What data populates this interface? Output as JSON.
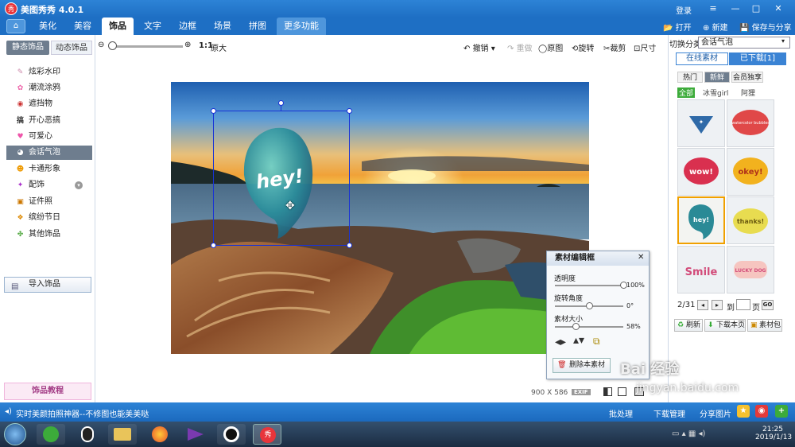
{
  "window": {
    "title": "美图秀秀 4.0.1",
    "logo_text": "秀",
    "login": "登录"
  },
  "window_controls": {
    "menu": "≡",
    "minimize": "—",
    "maximize": "□",
    "close": "✕"
  },
  "tabs": [
    {
      "label": "美化"
    },
    {
      "label": "美容"
    },
    {
      "label": "饰品"
    },
    {
      "label": "文字"
    },
    {
      "label": "边框"
    },
    {
      "label": "场景"
    },
    {
      "label": "拼图"
    },
    {
      "label": "更多功能 ▾"
    }
  ],
  "header_actions": {
    "open": "打开",
    "new": "新建",
    "save": "保存与分享"
  },
  "left_panel": {
    "tab_static": "静态饰品",
    "tab_dynamic": "动态饰品",
    "categories": [
      {
        "label": "炫彩水印",
        "icon": "✎"
      },
      {
        "label": "潮流涂鸦",
        "icon": "✿"
      },
      {
        "label": "遮挡物",
        "icon": "◉"
      },
      {
        "label": "开心恶搞",
        "icon": "搞"
      },
      {
        "label": "可爱心",
        "icon": "♥"
      },
      {
        "label": "会话气泡",
        "icon": "◕"
      },
      {
        "label": "卡通形象",
        "icon": "☻"
      },
      {
        "label": "配饰",
        "icon": "✦"
      },
      {
        "label": "证件照",
        "icon": "▣"
      },
      {
        "label": "缤纷节日",
        "icon": "❖"
      },
      {
        "label": "其他饰品",
        "icon": "✤"
      }
    ],
    "selected": "会话气泡",
    "import": "导入饰品",
    "tutorial": "饰品教程"
  },
  "toolbar": {
    "ratio": "1:1",
    "original_size": "原大",
    "undo": "撤销",
    "redo": "重做",
    "original": "原图",
    "rotate": "旋转",
    "crop": "裁剪",
    "resize": "尺寸"
  },
  "canvas": {
    "sticker_text": "hey!",
    "width": "900",
    "times": "X",
    "height": "586",
    "exif": "EXIF"
  },
  "editor": {
    "title": "素材编辑框",
    "opacity_label": "透明度",
    "opacity_value": "100%",
    "opacity_level": 1.0,
    "rotate_label": "旋转角度",
    "rotate_value": "0°",
    "rotate_level": 0.5,
    "size_label": "素材大小",
    "size_value": "58%",
    "size_level": 0.3,
    "delete": "删除本素材"
  },
  "right_panel": {
    "switch_label": "切换分类",
    "category": "会话气泡",
    "tab_online": "在线素材",
    "tab_downloaded": "已下载[1]",
    "chips": [
      "热门",
      "新鲜",
      "会员独享"
    ],
    "filters": [
      "全部",
      "冰雪girl",
      "阿狸"
    ],
    "thumbs": [
      {
        "text": "✦",
        "color": "#2f6aa8"
      },
      {
        "text": "watercolor bubbles",
        "color": "#e04848"
      },
      {
        "text": "wow!",
        "color": "#d9304f"
      },
      {
        "text": "okey!",
        "color": "#e48a1c"
      },
      {
        "text": "hey!",
        "color": "#2a8a96"
      },
      {
        "text": "thanks!",
        "color": "#c5b32a"
      },
      {
        "text": "Smile",
        "color": "#d24b79"
      },
      {
        "text": "LUCKY DOG",
        "color": "#d24b79"
      }
    ],
    "page": "2/31",
    "goto_label": "到",
    "page_suffix": "页",
    "go": "GO",
    "refresh": "刷新",
    "download_page": "下载本页",
    "library": "素材包"
  },
  "status_bar": {
    "message": "实时美颜拍照神器--不修图也能美美哒",
    "batch": "批处理",
    "downloads": "下载管理",
    "share": "分享图片"
  },
  "taskbar": {
    "time": "21:25",
    "date": "2019/1/13"
  },
  "watermark": {
    "line1": "Bai 经验",
    "line2": "jingyan.baidu.com"
  }
}
